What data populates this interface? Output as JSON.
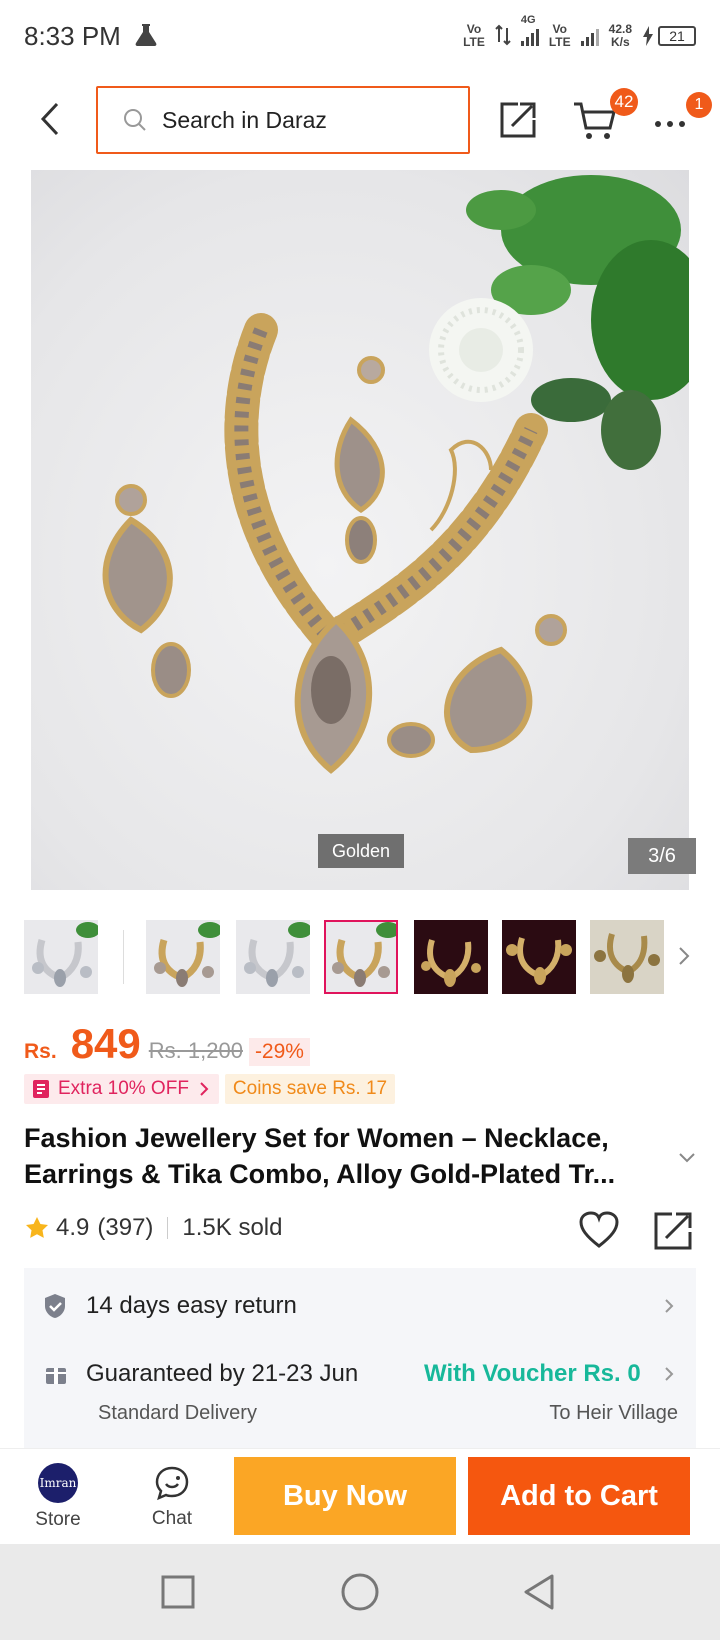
{
  "status_bar": {
    "time": "8:33 PM",
    "net_speed_value": "42.8",
    "net_speed_unit": "K/s",
    "battery": "21",
    "sim1_label_top": "Vo",
    "sim1_label_bottom": "LTE",
    "sim2_label_top": "Vo",
    "sim2_label_bottom": "LTE",
    "network_type": "4G"
  },
  "top_nav": {
    "search_placeholder": "Search in Daraz",
    "cart_count": "42",
    "more_badge": "1"
  },
  "gallery": {
    "variant_label": "Golden",
    "image_counter": "3/6",
    "thumbnail_count": 7,
    "selected_thumbnail": 4
  },
  "price": {
    "currency": "Rs.",
    "current": "849",
    "original": "Rs. 1,200",
    "discount": "-29%"
  },
  "promos": {
    "extra_off": "Extra 10% OFF",
    "coins": "Coins save Rs. 17"
  },
  "product": {
    "title": "Fashion Jewellery Set for Women – Necklace, Earrings & Tika Combo, Alloy Gold-Plated Tr..."
  },
  "stats": {
    "rating": "4.9",
    "reviews": "(397)",
    "sold": "1.5K sold"
  },
  "services": {
    "return": "14 days easy return",
    "delivery_guarantee": "Guaranteed by 21-23 Jun",
    "voucher": "With Voucher Rs. 0",
    "delivery_type": "Standard Delivery",
    "destination": "To Heir Village"
  },
  "bottom_bar": {
    "store_label": "Store",
    "store_logo_text": "Imran",
    "chat_label": "Chat",
    "buy_now": "Buy Now",
    "add_to_cart": "Add to Cart"
  },
  "colors": {
    "brand": "#f05a1a",
    "buy_now": "#fba625",
    "add_to_cart": "#f5570f",
    "voucher": "#17b89a",
    "selected_thumb": "#e0145c"
  }
}
